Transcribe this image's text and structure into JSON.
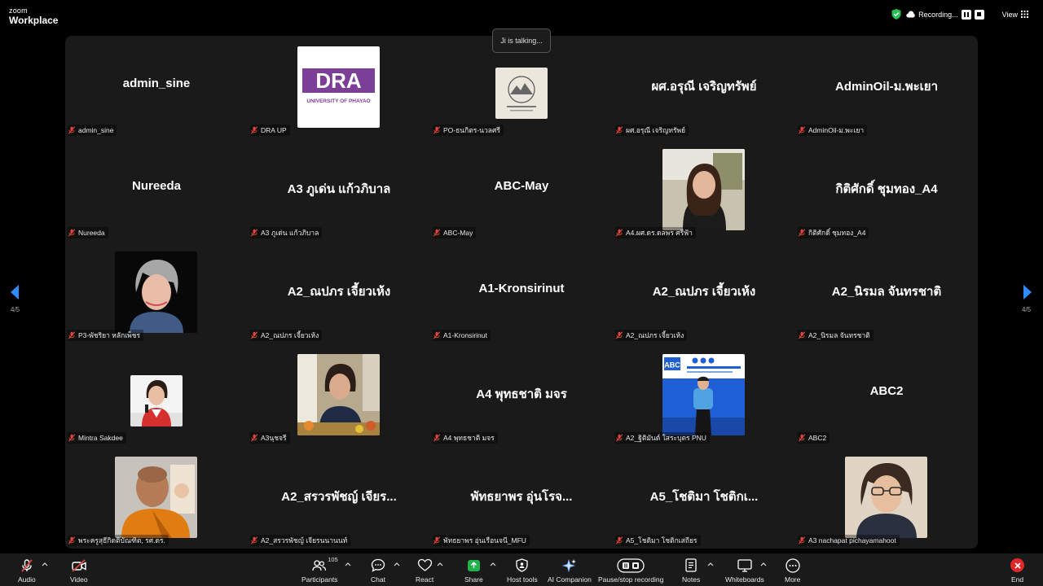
{
  "app": {
    "brand_line1": "zoom",
    "brand_line2": "Workplace"
  },
  "topbar": {
    "recording_label": "Recording...",
    "view_label": "View"
  },
  "speaking": "Ji is talking...",
  "pagination": {
    "left": "4/5",
    "right": "4/5"
  },
  "tiles": [
    {
      "big": "admin_sine",
      "label": "admin_sine"
    },
    {
      "photo": "dra-logo",
      "logo_main": "DRA",
      "logo_sub": "UNIVERSITY OF PHAYAO",
      "label": "DRA UP"
    },
    {
      "photo": "mountain-logo",
      "label": "PO-ธนกิตร-นวลศรี"
    },
    {
      "big": "ผศ.อรุณี เจริญทรัพย์",
      "label": "ผศ.อรุณี เจริญทรัพย์"
    },
    {
      "big": "AdminOil-ม.พะเยา",
      "label": "AdminOil-ม.พะเยา"
    },
    {
      "big": "Nureeda",
      "label": "Nureeda"
    },
    {
      "big": "A3 ภูเด่น แก้วภิบาล",
      "label": "A3 ภูเด่น แก้วภิบาล"
    },
    {
      "big": "ABC-May",
      "label": "ABC-May"
    },
    {
      "photo": "woman-car",
      "label": "A4.ผศ.ดร.ดลพร ศรีฟ้า"
    },
    {
      "big": "กิติศักดิ์ ชุมทอง_A4",
      "label": "กิติศักดิ์ ชุมทอง_A4"
    },
    {
      "photo": "woman-short-hair",
      "label": "P3-พัชริยา หลักเพ็ชร"
    },
    {
      "big": "A2_ณปภร เจี้ยวเห้ง",
      "label": "A2_ณปภร เจี้ยวเห้ง"
    },
    {
      "big": "A1-Kronsirinut",
      "label": "A1-Kronsirinut"
    },
    {
      "big": "A2_ณปภร เจี้ยวเห้ง",
      "label": "A2_ณปภร เจี้ยวเห้ง"
    },
    {
      "big": "A2_นิรมล จันทรชาติ",
      "label": "A2_นิรมล จันทรชาติ"
    },
    {
      "photo": "speaker-small",
      "label": "Mintra Sakdee"
    },
    {
      "photo": "woman-meeting",
      "label": "A3นุชจรี"
    },
    {
      "big": "A4 พุทธชาติ มจร",
      "label": "A4 พุทธชาติ มจร"
    },
    {
      "photo": "abc-stage",
      "stage_text": "ABC",
      "label": "A2_ฐิติมันต์ ใสระบุตร PNU"
    },
    {
      "big": "ABC2",
      "label": "ABC2"
    },
    {
      "photo": "monk",
      "label": "พระครูสุธีกิตติบัณฑิต, รศ.ดร."
    },
    {
      "big": "A2_สรวรพัชญ์ เจียร...",
      "label": "A2_สรวรพัชญ์ เจียรนนานนท์"
    },
    {
      "big": "พัทธยาพร อุ่นโรจ...",
      "label": "พัทธยาพร อุ่นเรือนจนี_MFU"
    },
    {
      "big": "A5_โชติมา โชติกเ...",
      "label": "A5_โชติมา โชติกเสถียร"
    },
    {
      "photo": "woman-glasses",
      "label": "A3 nachapat pichayamahoot"
    }
  ],
  "toolbar": {
    "audio": "Audio",
    "video": "Video",
    "participants": "Participants",
    "participants_count": "105",
    "chat": "Chat",
    "react": "React",
    "share": "Share",
    "host_tools": "Host tools",
    "ai_companion": "AI Companion",
    "recording": "Pause/stop recording",
    "notes": "Notes",
    "whiteboards": "Whiteboards",
    "more": "More",
    "end": "End"
  },
  "colors": {
    "accent_blue": "#2d8cff",
    "share_green": "#22b24c",
    "end_red": "#e02828",
    "muted_red": "#e0463c"
  }
}
